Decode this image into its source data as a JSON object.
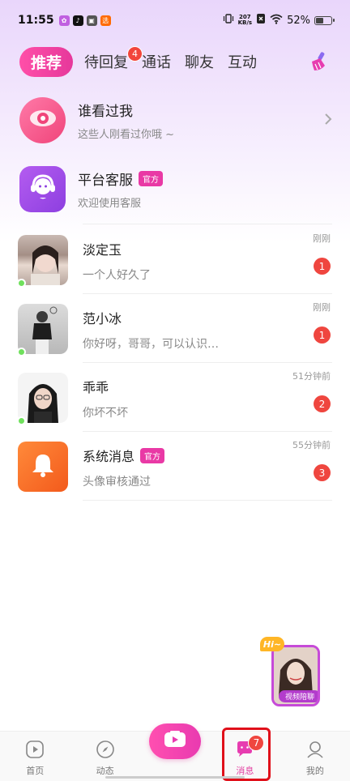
{
  "status_bar": {
    "time": "11:55",
    "net_speed_value": "207",
    "net_speed_unit": "KB/s",
    "battery": "52%",
    "battery_level": 0.52
  },
  "tabs": [
    {
      "label": "推荐",
      "active": true
    },
    {
      "label": "待回复",
      "badge": "4"
    },
    {
      "label": "通话"
    },
    {
      "label": "聊友"
    },
    {
      "label": "互动"
    }
  ],
  "features": {
    "visitors": {
      "title": "谁看过我",
      "subtitle": "这些人刚看过你哦 ~"
    },
    "support": {
      "title": "平台客服",
      "badge": "官方",
      "subtitle": "欢迎使用客服"
    }
  },
  "conversations": [
    {
      "name": "淡定玉",
      "message": "一个人好久了",
      "time": "刚刚",
      "unread": "1",
      "online": true
    },
    {
      "name": "范小冰",
      "message": "你好呀，哥哥，可以认识…",
      "time": "刚刚",
      "unread": "1",
      "online": true
    },
    {
      "name": "乖乖",
      "message": "你坏不坏",
      "time": "51分钟前",
      "unread": "2",
      "online": true
    },
    {
      "name": "系统消息",
      "badge": "官方",
      "message": "头像审核通过",
      "time": "55分钟前",
      "unread": "3",
      "online": false
    }
  ],
  "floating_video": {
    "hi": "Hi~",
    "label": "视频陪聊"
  },
  "bottom_nav": [
    {
      "label": "首页"
    },
    {
      "label": "动态"
    },
    {
      "label": "消息",
      "badge": "7",
      "active": true
    },
    {
      "label": "我的"
    }
  ],
  "colors": {
    "accent_pink": "#e939a5",
    "badge_red": "#ef463f",
    "online_green": "#6fe05c"
  }
}
